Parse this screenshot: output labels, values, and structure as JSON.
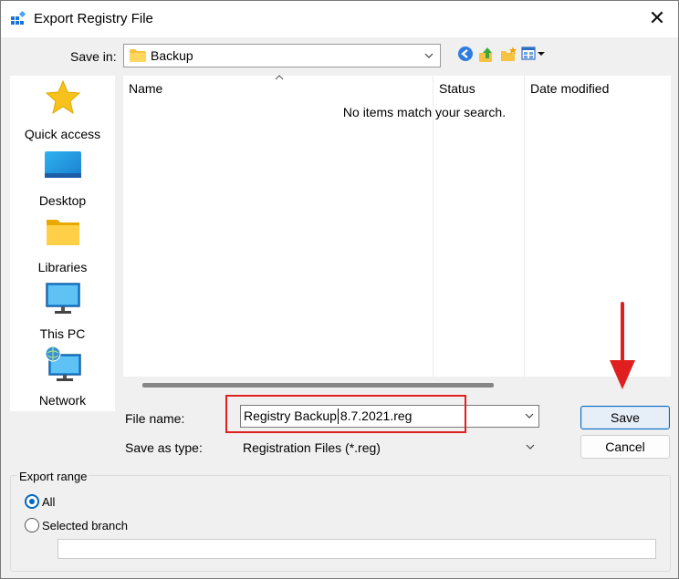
{
  "window": {
    "title": "Export Registry File",
    "close_glyph": "✕"
  },
  "toolbar": {
    "save_in_label": "Save in:",
    "save_in_value": "Backup",
    "buttons": [
      "back-icon",
      "up-folder-icon",
      "new-folder-icon",
      "view-menu-icon"
    ]
  },
  "places": [
    {
      "label": "Quick access",
      "icon": "star-icon"
    },
    {
      "label": "Desktop",
      "icon": "desktop-icon"
    },
    {
      "label": "Libraries",
      "icon": "libraries-icon"
    },
    {
      "label": "This PC",
      "icon": "monitor-icon"
    },
    {
      "label": "Network",
      "icon": "network-icon"
    }
  ],
  "filelist": {
    "columns": [
      "Name",
      "Status",
      "Date modified"
    ],
    "empty_message": "No items match your search."
  },
  "form": {
    "file_name_label": "File name:",
    "file_name_value": "Registry Backup 8.7.2021.reg",
    "save_type_label": "Save as type:",
    "save_type_value": "Registration Files (*.reg)"
  },
  "buttons": {
    "save": "Save",
    "cancel": "Cancel"
  },
  "export_range": {
    "title": "Export range",
    "options": [
      {
        "label": "All",
        "checked": true
      },
      {
        "label": "Selected branch",
        "checked": false
      }
    ],
    "branch_value": ""
  },
  "colors": {
    "accent": "#0067c0",
    "highlight": "#e02020"
  }
}
